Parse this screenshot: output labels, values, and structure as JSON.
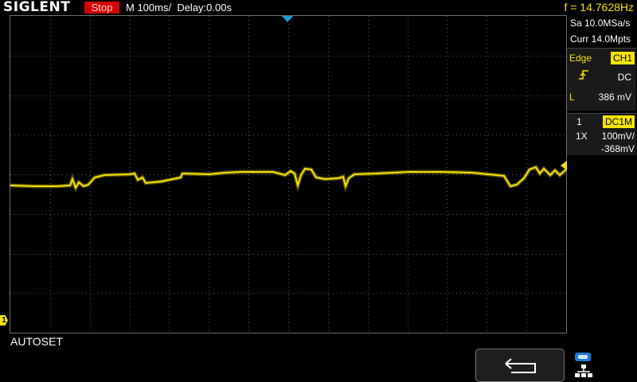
{
  "header": {
    "brand": "SIGLENT",
    "run_state": "Stop",
    "timebase": "M 100ms/",
    "delay": "Delay:0.00s",
    "frequency": "f = 14.7628Hz"
  },
  "acquisition": {
    "sample_rate": "Sa 10.0MSa/s",
    "memory": "Curr 14.0Mpts"
  },
  "trigger": {
    "type_label": "Edge",
    "source": "CH1",
    "coupling": "DC",
    "level_label": "L",
    "level_value": "386 mV"
  },
  "channel": {
    "number": "1",
    "mode": "DC1M",
    "probe": "1X",
    "scale": "100mV/",
    "offset": "-368mV",
    "marker": "1"
  },
  "status_message": "AUTOSET",
  "colors": {
    "trace": "#f5e300",
    "trigger_marker": "#1e9cd7",
    "stop_bg": "#d40000"
  },
  "icons": {
    "back": "return-arrow-icon",
    "system": "usb-network-icon"
  }
}
